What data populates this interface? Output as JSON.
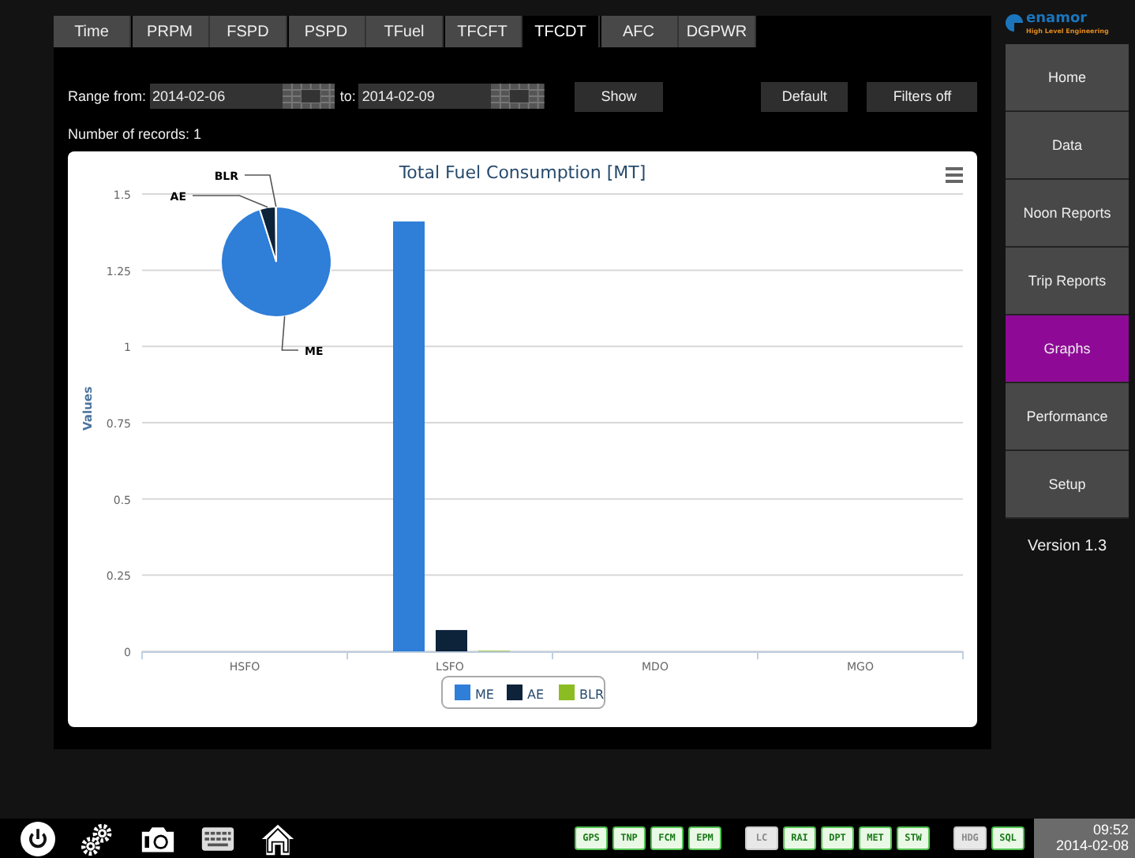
{
  "tabs": [
    {
      "label": "Time",
      "selected": false
    },
    {
      "label": "PRPM",
      "selected": false
    },
    {
      "label": "FSPD",
      "selected": false
    },
    {
      "label": "PSPD",
      "selected": false
    },
    {
      "label": "TFuel",
      "selected": false
    },
    {
      "label": "TFCFT",
      "selected": false
    },
    {
      "label": "TFCDT",
      "selected": true
    },
    {
      "label": "AFC",
      "selected": false
    },
    {
      "label": "DGPWR",
      "selected": false
    }
  ],
  "filters": {
    "range_from_label": "Range from:",
    "from": "2014-02-06",
    "to_label": "to:",
    "to": "2014-02-09",
    "show_button": "Show",
    "default_button": "Default",
    "filters_off_button": "Filters off"
  },
  "records": "Number of records: 1",
  "chart_data": {
    "type": "bar",
    "title": "Total Fuel Consumption [MT]",
    "ylabel": "Values",
    "categories": [
      "HSFO",
      "LSFO",
      "MDO",
      "MGO"
    ],
    "ylim": [
      0,
      1.5
    ],
    "grid": true,
    "legend": "bottom",
    "yticks": [
      0,
      0.25,
      0.5,
      0.75,
      1,
      1.25,
      1.5
    ],
    "series": [
      {
        "name": "ME",
        "color": "#2f7ed8",
        "values": [
          0,
          1.41,
          0,
          0
        ]
      },
      {
        "name": "AE",
        "color": "#0d233a",
        "values": [
          0,
          0.07,
          0,
          0
        ]
      },
      {
        "name": "BLR",
        "color": "#8bbc21",
        "values": [
          0,
          0.002,
          0,
          0
        ]
      }
    ]
  },
  "logo": {
    "name": "enamor",
    "tagline": "High Level Engineering"
  },
  "sidebar": {
    "items": [
      {
        "label": "Home",
        "selected": false
      },
      {
        "label": "Data",
        "selected": false
      },
      {
        "label": "Noon Reports",
        "selected": false
      },
      {
        "label": "Trip Reports",
        "selected": false
      },
      {
        "label": "Graphs",
        "selected": true
      },
      {
        "label": "Performance",
        "selected": false
      },
      {
        "label": "Setup",
        "selected": false
      }
    ],
    "version": "Version 1.3"
  },
  "status_badges": [
    {
      "label": "GPS",
      "enabled": true
    },
    {
      "label": "TNP",
      "enabled": true
    },
    {
      "label": "FCM",
      "enabled": true
    },
    {
      "label": "EPM",
      "enabled": true
    },
    {
      "label": "LC",
      "enabled": false
    },
    {
      "label": "RAI",
      "enabled": true
    },
    {
      "label": "DPT",
      "enabled": true
    },
    {
      "label": "MET",
      "enabled": true
    },
    {
      "label": "STW",
      "enabled": true
    },
    {
      "label": "HDG",
      "enabled": false
    },
    {
      "label": "SQL",
      "enabled": true
    }
  ],
  "clock": {
    "time": "09:52",
    "date": "2014-02-08"
  }
}
